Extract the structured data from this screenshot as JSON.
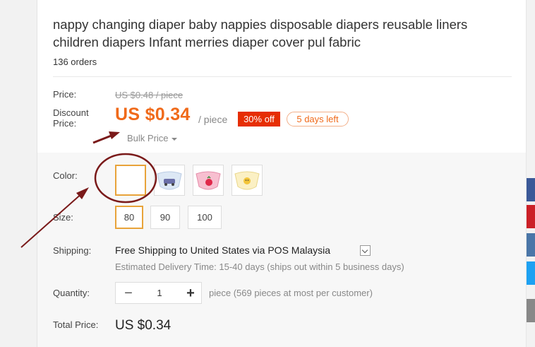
{
  "product": {
    "title_line1": "nappy changing diaper baby nappies disposable diapers reusable liners",
    "title_line2": "children diapers Infant merries diaper cover pul fabric",
    "orders": "136 orders"
  },
  "pricing": {
    "price_label": "Price:",
    "old_price": "US $0.48 / piece",
    "discount_label_1": "Discount",
    "discount_label_2": "Price:",
    "price": "US $0.34",
    "per_piece": "/ piece",
    "off_badge": "30% off",
    "days_left": "5 days left",
    "bulk_price": "Bulk Price"
  },
  "options": {
    "color_label": "Color:",
    "colors": [
      "white",
      "blue-car",
      "pink-strawberry",
      "yellow-chick"
    ],
    "selected_color_index": 0,
    "size_label": "Size:",
    "sizes": [
      "80",
      "90",
      "100"
    ],
    "selected_size_index": 0
  },
  "shipping": {
    "label": "Shipping:",
    "main": "Free Shipping to United States via POS Malaysia",
    "estimate": "Estimated Delivery Time: 15-40 days (ships out within 5 business days)"
  },
  "quantity": {
    "label": "Quantity:",
    "minus": "−",
    "value": "1",
    "plus": "+",
    "note": "piece (569 pieces at most per customer)"
  },
  "total": {
    "label": "Total Price:",
    "value": "US $0.34"
  },
  "social": [
    {
      "name": "facebook-icon",
      "color": "#3b5998"
    },
    {
      "name": "pinterest-icon",
      "color": "#cb2027"
    },
    {
      "name": "vk-icon",
      "color": "#4a76a8"
    },
    {
      "name": "twitter-icon",
      "color": "#1da1f2"
    },
    {
      "name": "more-share-icon",
      "color": "#888888"
    }
  ],
  "colors": {
    "accent_orange": "#f06a1a",
    "badge_red": "#e62e04",
    "selected_border": "#e8a33a",
    "annotation": "#7a1a1a"
  }
}
